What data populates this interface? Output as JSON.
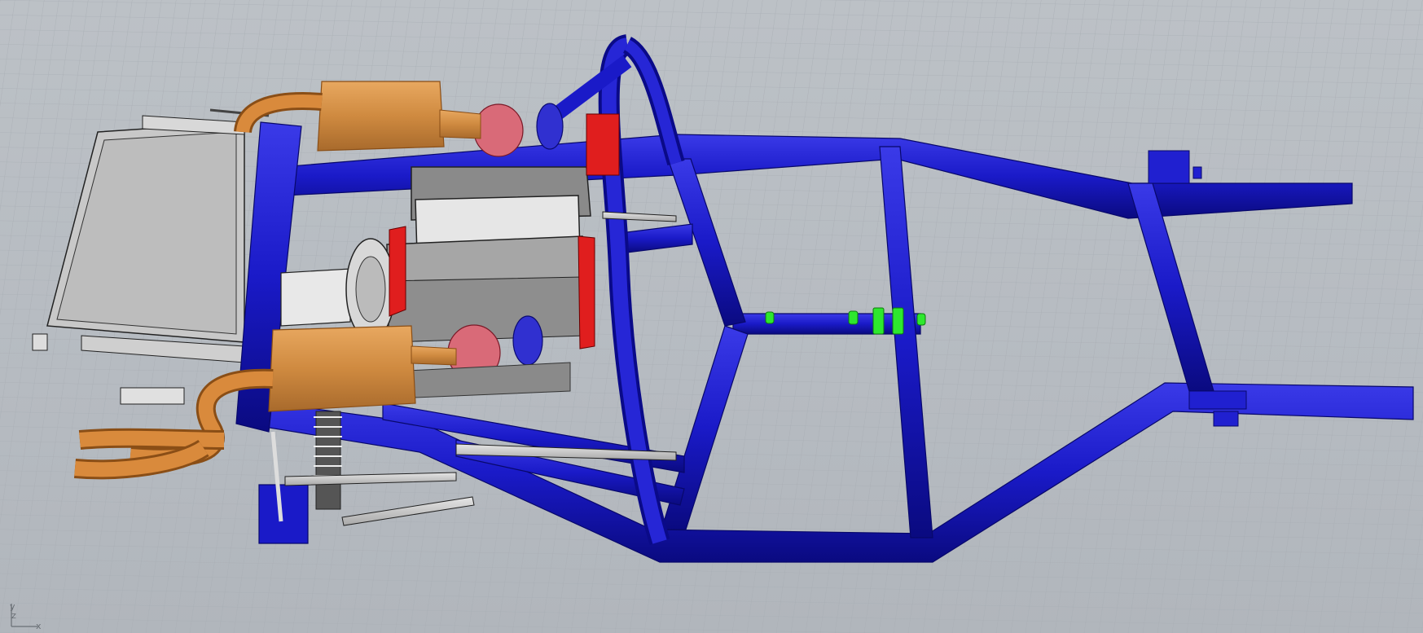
{
  "viewport": {
    "projection": "perspective",
    "display_mode": "shaded",
    "background_color": "#b9bec4",
    "grid": true
  },
  "axis_widget": {
    "x_label": "x",
    "y_label": "y",
    "z_label": "z"
  },
  "colors": {
    "frame": "#1a1ac8",
    "frame_dark": "#0c0c8a",
    "exhaust": "#d98a3c",
    "turbo": "#d96a78",
    "engine": "#d0d0d0",
    "engine_dark": "#7d7d7d",
    "highlight_red": "#e01e1e",
    "selection_green": "#2ee82e"
  },
  "objects": [
    {
      "name": "chassis-frame",
      "color": "frame"
    },
    {
      "name": "roll-hoop",
      "color": "frame"
    },
    {
      "name": "engine-block",
      "color": "engine"
    },
    {
      "name": "radiator",
      "color": "engine"
    },
    {
      "name": "exhaust-muffler",
      "color": "exhaust"
    },
    {
      "name": "turbocharger",
      "color": "turbo"
    },
    {
      "name": "suspension-assembly",
      "color": "engine"
    },
    {
      "name": "selected-mounts",
      "color": "selection_green"
    }
  ]
}
